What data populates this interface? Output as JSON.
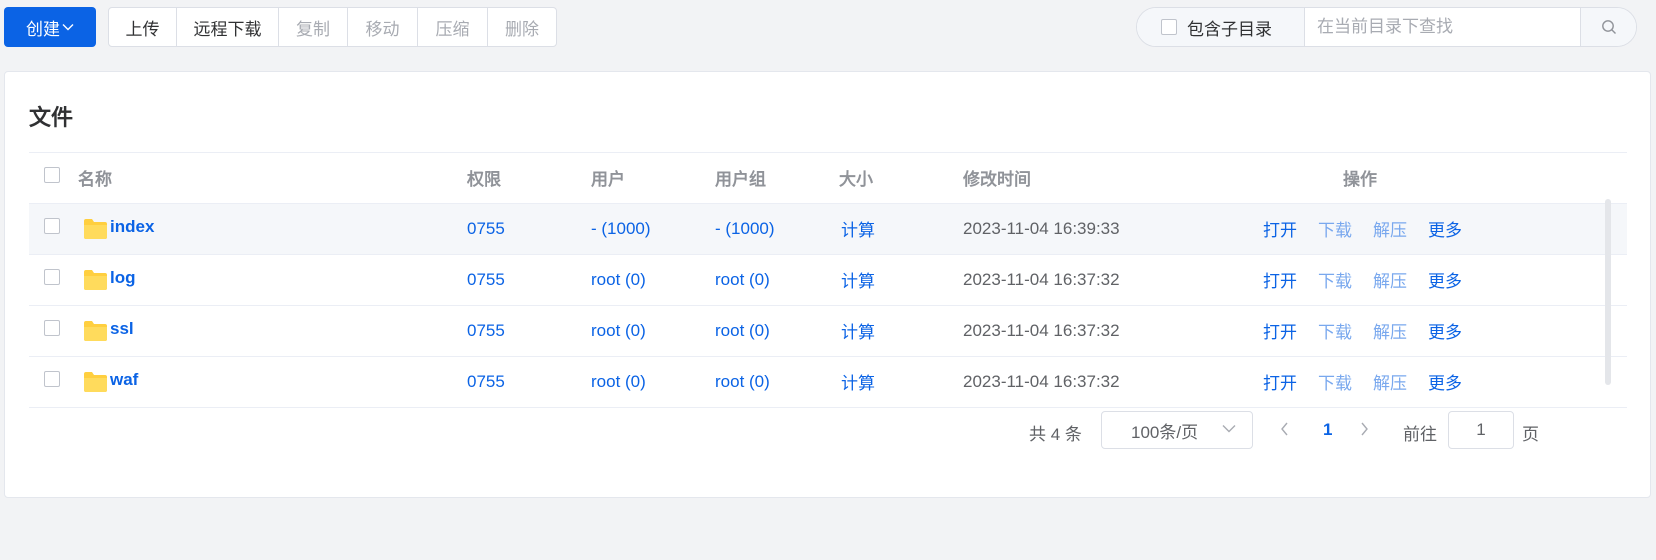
{
  "toolbar": {
    "create_label": "创建",
    "buttons": [
      {
        "label": "上传",
        "disabled": false
      },
      {
        "label": "远程下载",
        "disabled": false
      },
      {
        "label": "复制",
        "disabled": true
      },
      {
        "label": "移动",
        "disabled": true
      },
      {
        "label": "压缩",
        "disabled": true
      },
      {
        "label": "删除",
        "disabled": true
      }
    ],
    "include_subdir_label": "包含子目录",
    "search_placeholder": "在当前目录下查找"
  },
  "card": {
    "title": "文件"
  },
  "table": {
    "columns": [
      "名称",
      "权限",
      "用户",
      "用户组",
      "大小",
      "修改时间",
      "操作"
    ],
    "rows": [
      {
        "name": "index",
        "perm": "0755",
        "user": "- (1000)",
        "group": "- (1000)",
        "size": "计算",
        "mtime": "2023-11-04 16:39:33"
      },
      {
        "name": "log",
        "perm": "0755",
        "user": "root (0)",
        "group": "root (0)",
        "size": "计算",
        "mtime": "2023-11-04 16:37:32"
      },
      {
        "name": "ssl",
        "perm": "0755",
        "user": "root (0)",
        "group": "root (0)",
        "size": "计算",
        "mtime": "2023-11-04 16:37:32"
      },
      {
        "name": "waf",
        "perm": "0755",
        "user": "root (0)",
        "group": "root (0)",
        "size": "计算",
        "mtime": "2023-11-04 16:37:32"
      }
    ],
    "actions": {
      "open": "打开",
      "download": "下载",
      "extract": "解压",
      "more": "更多"
    }
  },
  "pagination": {
    "total_label": "共 4 条",
    "page_size_label": "100条/页",
    "current_page": "1",
    "goto_label": "前往",
    "goto_value": "1",
    "page_suffix": "页"
  },
  "colors": {
    "primary": "#0b63e5",
    "disabled_link": "#79a8ee",
    "folder": "#ffd24d"
  }
}
